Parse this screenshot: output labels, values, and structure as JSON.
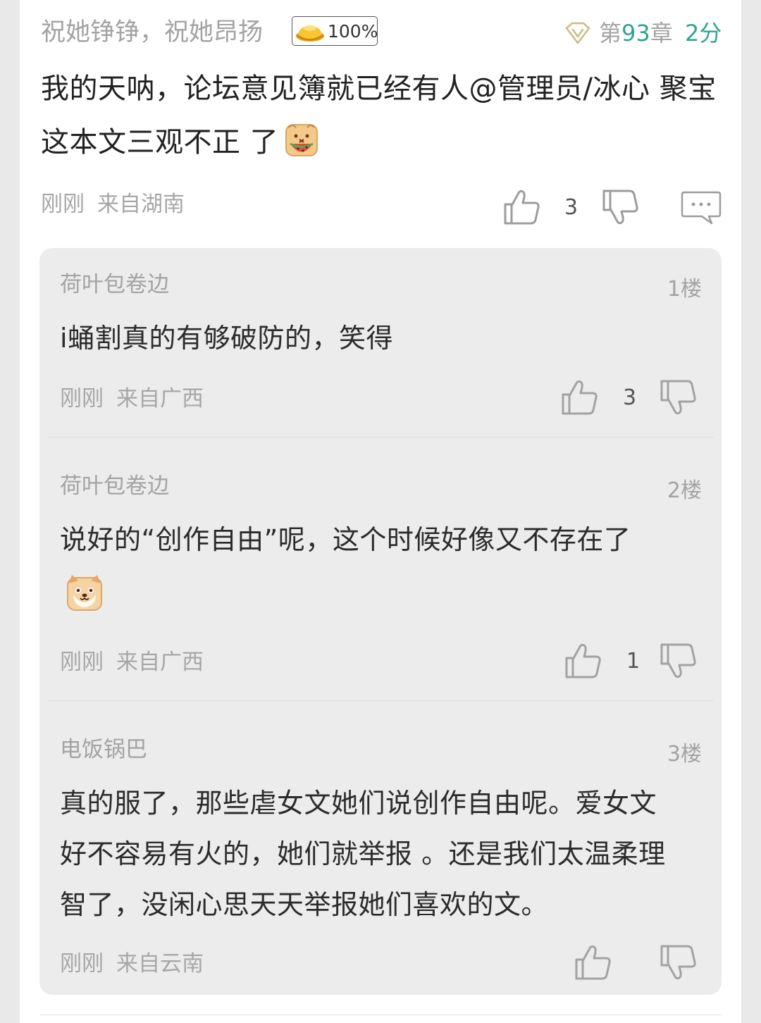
{
  "post": {
    "username": "祝她铮铮，祝她昂扬",
    "badge_percent": "100%",
    "badge_icon": "gold-ingot-icon",
    "vip_icon": "vip-diamond-icon",
    "chapter_prefix": "第",
    "chapter_number": "93",
    "chapter_suffix": "章",
    "score": "2分",
    "content_line1": "我的天呐，论坛意见簿就已经有人@管理员/冰心 聚宝",
    "content_line2": "这本文三观不正 了",
    "content_emoji": "watermelon-bread-emoji",
    "time": "刚刚",
    "location": "来自湖南",
    "like_count": "3"
  },
  "replies": [
    {
      "author": "荷叶包卷边",
      "floor": "1楼",
      "lines": [
        "i蛹割真的有够破防的，笑得"
      ],
      "time": "刚刚",
      "location": "来自广西",
      "like_count": "3"
    },
    {
      "author": "荷叶包卷边",
      "floor": "2楼",
      "lines": [
        "说好的“创作自由”呢，这个时候好像又不存在了"
      ],
      "emoji": "shiba-dog-emoji",
      "time": "刚刚",
      "location": "来自广西",
      "like_count": "1"
    },
    {
      "author": "电饭锅巴",
      "floor": "3楼",
      "lines": [
        "真的服了，那些虐女文她们说创作自由呢。爱女文",
        "好不容易有火的，她们就举报 。还是我们太温柔理",
        "智了，没闲心思天天举报她们喜欢的文。"
      ],
      "time": "刚刚",
      "location": "来自云南",
      "like_count": ""
    }
  ],
  "colors": {
    "accent_green": "#2fa58e",
    "muted_text": "#a3a3a3",
    "reply_bg": "#ececec"
  }
}
